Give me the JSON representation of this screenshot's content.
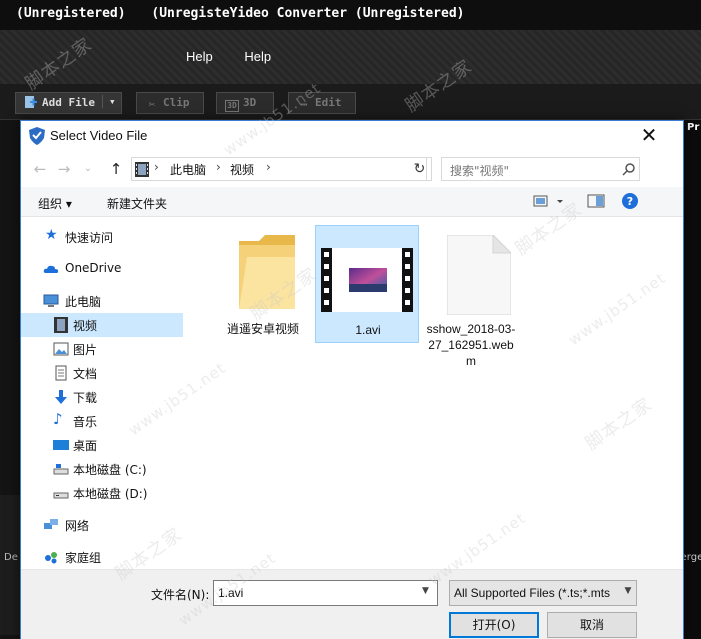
{
  "app": {
    "title_parts": [
      "(Unregistered)",
      "(UnregisteYideo Converter (Unregistered)"
    ],
    "menu": [
      "Help",
      "Help"
    ],
    "toolbar": {
      "add_file": "Add File",
      "clip": "Clip",
      "three_d": "3D",
      "edit": "Edit"
    },
    "right_label": "Pr",
    "merge_label": "Merge",
    "left_label": "De"
  },
  "dialog": {
    "title": "Select Video File",
    "address": {
      "crumbs": [
        "此电脑",
        "视频"
      ]
    },
    "search_placeholder": "搜索\"视频\"",
    "commands": {
      "organize": "组织 ▾",
      "new_folder": "新建文件夹"
    },
    "nav_items": [
      {
        "label": "快速访问",
        "icon": "star-icon"
      },
      {
        "label": "OneDrive",
        "icon": "cloud-icon"
      },
      {
        "label": "此电脑",
        "icon": "computer-icon"
      },
      {
        "label": "视频",
        "icon": "video-folder-icon",
        "selected": true
      },
      {
        "label": "图片",
        "icon": "pictures-icon"
      },
      {
        "label": "文档",
        "icon": "documents-icon"
      },
      {
        "label": "下载",
        "icon": "download-icon"
      },
      {
        "label": "音乐",
        "icon": "music-icon"
      },
      {
        "label": "桌面",
        "icon": "desktop-icon"
      },
      {
        "label": "本地磁盘 (C:)",
        "icon": "drive-icon"
      },
      {
        "label": "本地磁盘 (D:)",
        "icon": "drive-icon"
      },
      {
        "label": "网络",
        "icon": "network-icon"
      },
      {
        "label": "家庭组",
        "icon": "homegroup-icon"
      }
    ],
    "files": [
      {
        "name": "逍遥安卓视频",
        "type": "folder"
      },
      {
        "name": "1.avi",
        "type": "video",
        "selected": true
      },
      {
        "name_lines": [
          "sshow_2018-03-",
          "27_162951.web",
          "m"
        ],
        "type": "document"
      }
    ],
    "filename_label": "文件名(N):",
    "filename_value": "1.avi",
    "filter_value": "All Supported Files (*.ts;*.mts",
    "open_button": "打开(O)",
    "cancel_button": "取消"
  },
  "watermarks": [
    "脚本之家",
    "www.jb51.net"
  ]
}
